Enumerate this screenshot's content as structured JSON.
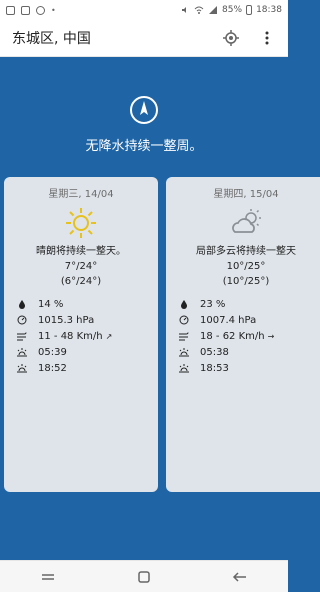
{
  "status_bar": {
    "battery": "85%",
    "time": "18:38"
  },
  "app_bar": {
    "title": "东城区, 中国"
  },
  "summary": {
    "text": "无降水持续一整周。"
  },
  "cards": [
    {
      "date": "星期三, 14/04",
      "icon": "sun-icon",
      "condition": "晴朗将持续一整天。",
      "temp": "7°/24°",
      "feels": "(6°/24°)",
      "humidity": "14 %",
      "pressure": "1015.3 hPa",
      "wind": "11 - 48 Km/h",
      "sunrise": "05:39",
      "sunset": "18:52"
    },
    {
      "date": "星期四, 15/04",
      "icon": "partly-cloudy-icon",
      "condition": "局部多云将持续一整天",
      "temp": "10°/25°",
      "feels": "(10°/25°)",
      "humidity": "23 %",
      "pressure": "1007.4 hPa",
      "wind": "18 - 62 Km/h",
      "sunrise": "05:38",
      "sunset": "18:53"
    }
  ],
  "colors": {
    "background": "#1f65a6",
    "card": "#dfe4ea",
    "sun": "#e7c21b"
  }
}
